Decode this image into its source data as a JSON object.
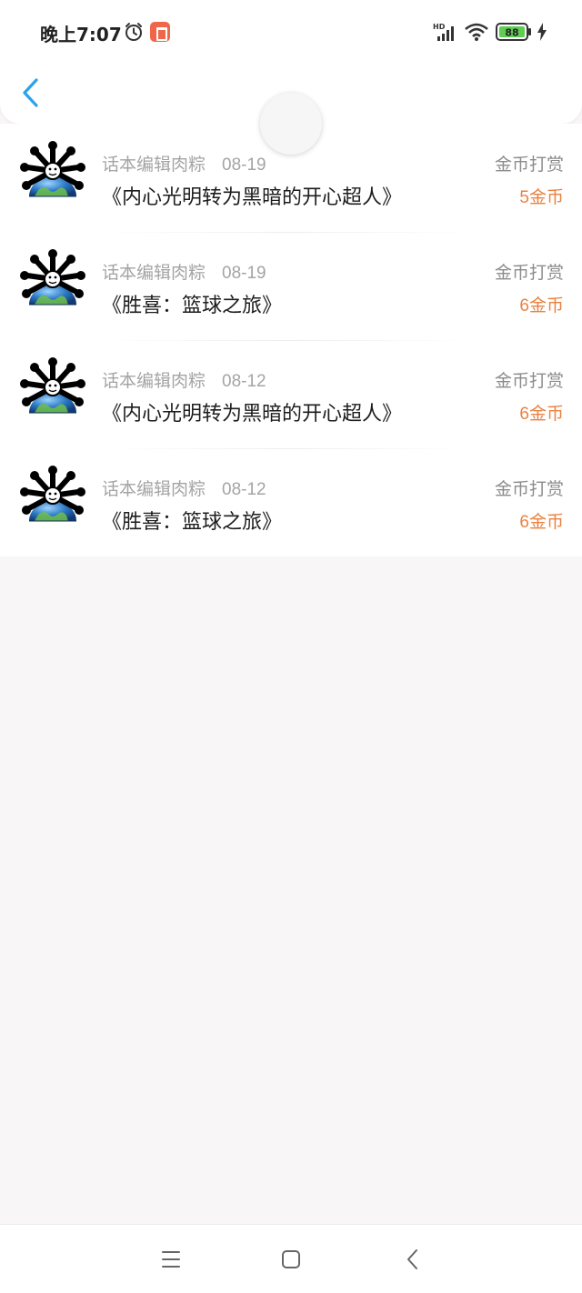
{
  "status_bar": {
    "time": "晚上7:07",
    "signal_label": "HD",
    "battery": "88"
  },
  "header": {
    "back_icon": "chevron-left-icon"
  },
  "records": [
    {
      "user": "话本编辑肉粽",
      "date": "08-19",
      "book": "《内心光明转为黑暗的开心超人》",
      "kind": "金币打赏",
      "amount": "5金币"
    },
    {
      "user": "话本编辑肉粽",
      "date": "08-19",
      "book": "《胜喜：篮球之旅》",
      "kind": "金币打赏",
      "amount": "6金币"
    },
    {
      "user": "话本编辑肉粽",
      "date": "08-12",
      "book": "《内心光明转为黑暗的开心超人》",
      "kind": "金币打赏",
      "amount": "6金币"
    },
    {
      "user": "话本编辑肉粽",
      "date": "08-12",
      "book": "《胜喜：篮球之旅》",
      "kind": "金币打赏",
      "amount": "6金币"
    }
  ],
  "colors": {
    "accent_blue": "#2aa3ec",
    "coin_orange": "#ea8241",
    "notif_orange": "#f0664a"
  },
  "nav_bar": {
    "icons": [
      "menu-icon",
      "home-icon",
      "back-icon"
    ]
  }
}
